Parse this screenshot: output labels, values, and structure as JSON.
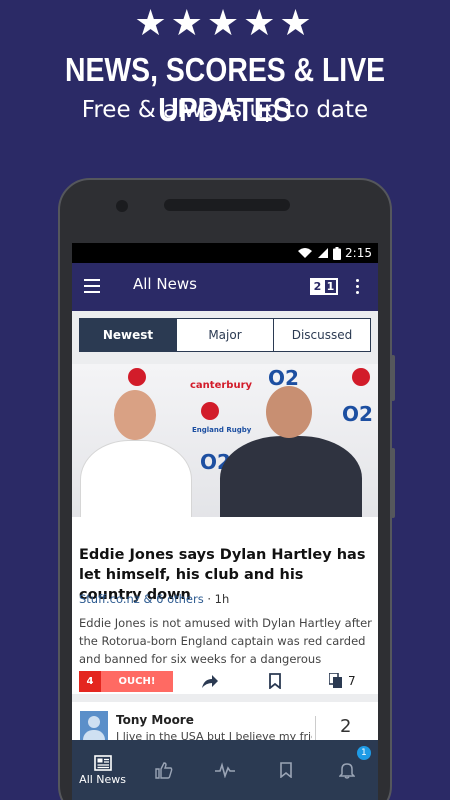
{
  "promo": {
    "stars": "★★★★★",
    "headline": "NEWS, SCORES & LIVE UPDATES",
    "subline": "Free & always up to date"
  },
  "status": {
    "time": "2:15"
  },
  "appbar": {
    "title": "All News"
  },
  "tabs": [
    {
      "label": "Newest",
      "active": true
    },
    {
      "label": "Major",
      "active": false
    },
    {
      "label": "Discussed",
      "active": false
    }
  ],
  "article": {
    "photo_texts": {
      "sponsor": "canterbury",
      "network": "O2",
      "crest": "England Rugby"
    },
    "title": "Eddie Jones says Dylan Hartley has let himself, his club and his country down",
    "source": "Stuff.co.nz & 6 others",
    "separator": "·",
    "age": "1h",
    "description": "Eddie Jones is not amused with Dylan Hartley after the Rotorua-born England captain was red carded and banned for six weeks for a dangerous swinging...",
    "reaction_count": "4",
    "reaction_label": "OUCH!",
    "related_count": "7"
  },
  "comment": {
    "author": "Tony Moore",
    "text": "I live in the USA but I believe my friends in",
    "count": "2"
  },
  "bottom_nav": {
    "items": [
      {
        "label": "All News",
        "icon": "newspaper-icon"
      },
      {
        "label": "",
        "icon": "thumbs-up-icon"
      },
      {
        "label": "",
        "icon": "pulse-icon"
      },
      {
        "label": "",
        "icon": "bookmark-icon"
      },
      {
        "label": "",
        "icon": "bell-icon"
      }
    ],
    "notification_count": "1"
  },
  "colors": {
    "background": "#2b2a66",
    "appbar": "#2b2a66",
    "bottom_nav": "#2b3a52",
    "tab_active": "#2b3a52",
    "ouch": "#ff6a63",
    "ouch_count": "#e4261f",
    "badge": "#1e9be6"
  }
}
